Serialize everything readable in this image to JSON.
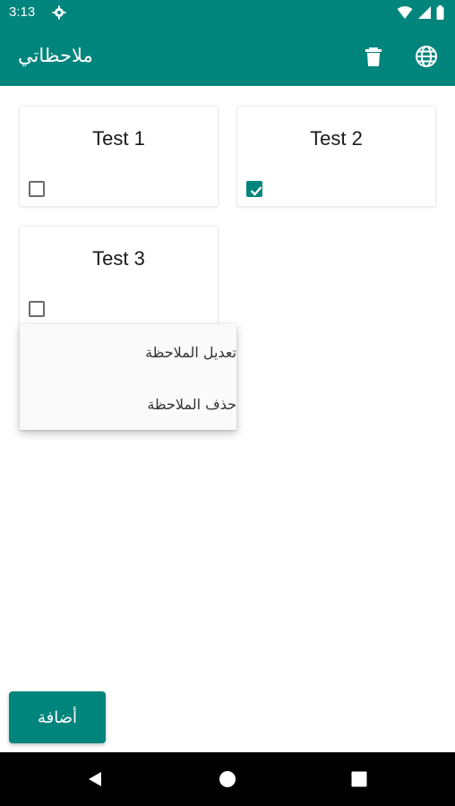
{
  "status_bar": {
    "time": "3:13",
    "icons": [
      "gear-icon",
      "wifi-icon",
      "signal-icon",
      "battery-icon"
    ]
  },
  "app_bar": {
    "title": "ملاحظاتي",
    "actions": [
      "trash-icon",
      "globe-icon"
    ]
  },
  "notes": [
    {
      "title": "Test 1",
      "checked": false
    },
    {
      "title": "Test 2",
      "checked": true
    },
    {
      "title": "Test 3",
      "checked": false
    }
  ],
  "context_menu": {
    "items": [
      {
        "label": "تعديل الملاحظة"
      },
      {
        "label": "حذف الملاحظة"
      }
    ]
  },
  "add_button": {
    "label": "أضافة"
  },
  "nav_bar": {
    "icons": [
      "back-icon",
      "home-icon",
      "recents-icon"
    ]
  },
  "colors": {
    "primary": "#00857d",
    "background": "#ffffff",
    "nav_bar": "#000000"
  }
}
